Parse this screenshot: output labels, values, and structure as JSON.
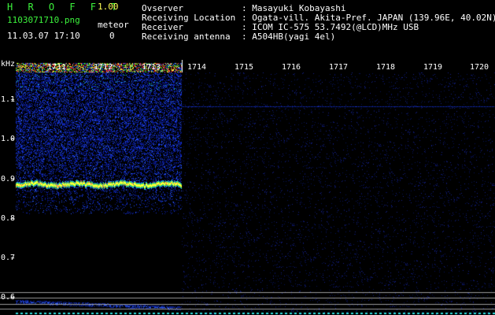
{
  "header": {
    "app_title": "H R O F F T",
    "app_version": "1.00",
    "file_name": "1103071710.png",
    "timestamp": "11.03.07 17:10",
    "meteor_label": "meteor",
    "meteor_count": "0"
  },
  "info": [
    {
      "label": "Ovserver",
      "value": ": Masayuki Kobayashi"
    },
    {
      "label": "Receiving Location",
      "value": ": Ogata-vill. Akita-Pref. JAPAN (139.96E, 40.02N)"
    },
    {
      "label": "Receiver",
      "value": ": ICOM IC-575 53.7492(@LCD)MHz USB"
    },
    {
      "label": "Receiving antenna",
      "value": ": A504HB(yagi 4el)"
    }
  ],
  "spectrogram": {
    "unit": "kHz",
    "y_ticks": [
      "1.1",
      "1.0",
      "0.9",
      "0.8",
      "0.7",
      "0.6"
    ],
    "x_ticks": [
      "1711",
      "1712",
      "1713",
      "1714",
      "1715",
      "1716",
      "1717",
      "1718",
      "1719",
      "1720"
    ],
    "colors": {
      "background": "#000000",
      "noise": "#1a3cff",
      "signal": "#ffff40",
      "hot": "#ff2020",
      "grid": "#9a9a9a"
    }
  }
}
